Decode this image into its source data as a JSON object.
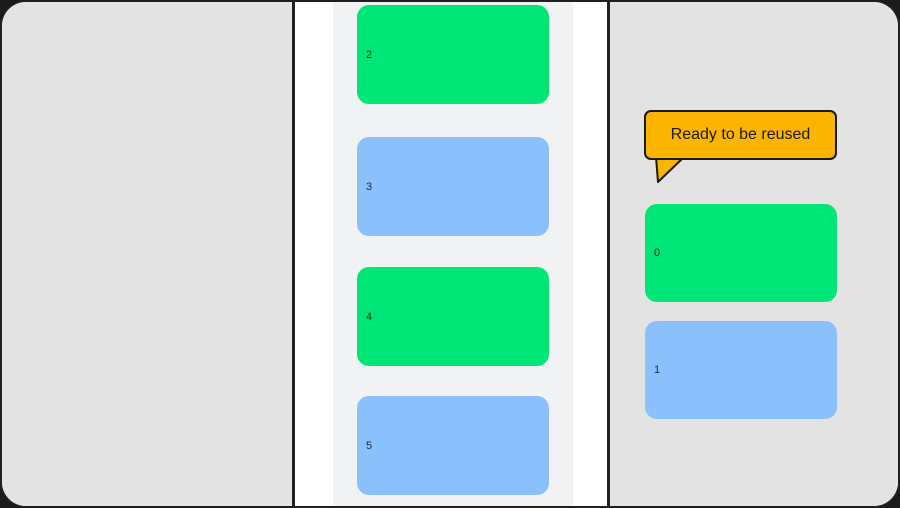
{
  "list_items": [
    {
      "label": "2",
      "color": "#00e676"
    },
    {
      "label": "3",
      "color": "#8ac1fc"
    },
    {
      "label": "4",
      "color": "#00e676"
    },
    {
      "label": "5",
      "color": "#8ac1fc"
    }
  ],
  "recycle_pool": {
    "callout_text": "Ready to be reused",
    "callout_color": "#fbb400",
    "items": [
      {
        "label": "0",
        "color": "#00e676"
      },
      {
        "label": "1",
        "color": "#8ac1fc"
      }
    ]
  }
}
